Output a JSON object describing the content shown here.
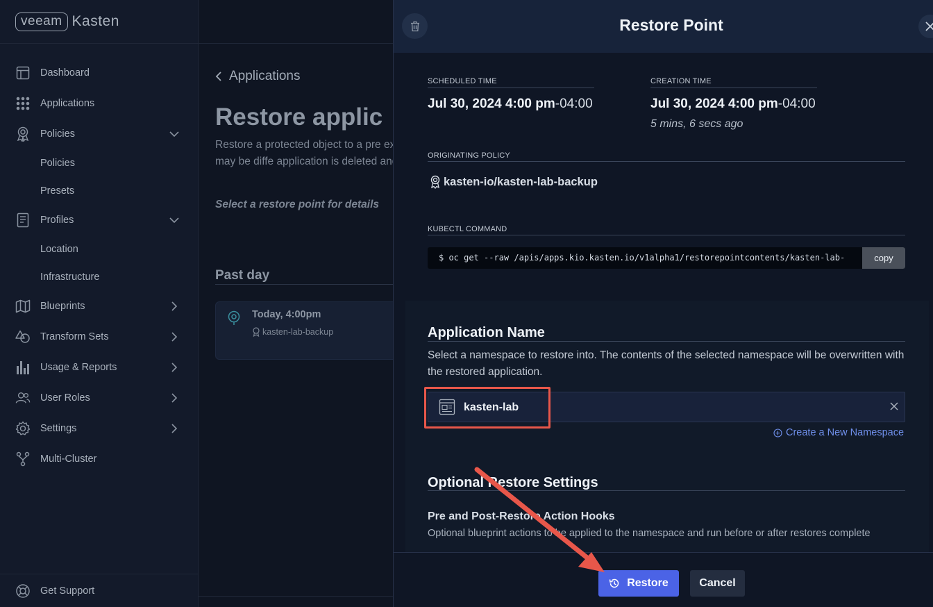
{
  "brand": {
    "veeam": "veeam",
    "kasten": "Kasten"
  },
  "sidebar": {
    "items": [
      {
        "label": "Dashboard",
        "icon": "dashboard-icon"
      },
      {
        "label": "Applications",
        "icon": "grid-icon"
      },
      {
        "label": "Policies",
        "icon": "badge-icon"
      },
      {
        "label": "Policies",
        "icon": ""
      },
      {
        "label": "Presets",
        "icon": ""
      },
      {
        "label": "Profiles",
        "icon": "document-icon"
      },
      {
        "label": "Location",
        "icon": ""
      },
      {
        "label": "Infrastructure",
        "icon": ""
      },
      {
        "label": "Blueprints",
        "icon": "map-icon"
      },
      {
        "label": "Transform Sets",
        "icon": "shapes-icon"
      },
      {
        "label": "Usage & Reports",
        "icon": "bar-chart-icon"
      },
      {
        "label": "User Roles",
        "icon": "users-icon"
      },
      {
        "label": "Settings",
        "icon": "gear-icon"
      },
      {
        "label": "Multi-Cluster",
        "icon": "fork-icon"
      }
    ],
    "support": "Get Support"
  },
  "main": {
    "back_label": "Applications",
    "title": "Restore applic",
    "description": "Restore a protected object to a pre execution time which may be diffe application is deleted and then rec",
    "hint": "Select a restore point for details",
    "section": "Past day",
    "card": {
      "time": "Today, 4:00pm",
      "policy": "kasten-lab-backup"
    }
  },
  "panel": {
    "title": "Restore Point",
    "scheduled_label": "SCHEDULED TIME",
    "scheduled_time": "Jul 30, 2024 4:00 pm",
    "scheduled_tz": "-04:00",
    "creation_label": "CREATION TIME",
    "creation_time": "Jul 30, 2024 4:00 pm",
    "creation_tz": "-04:00",
    "creation_ago": "5 mins, 6 secs ago",
    "policy_label": "ORIGINATING POLICY",
    "policy": "kasten-io/kasten-lab-backup",
    "kubectl_label": "KUBECTL COMMAND",
    "kubectl_cmd": "$ oc get --raw /apis/apps.kio.kasten.io/v1alpha1/restorepointcontents/kasten-lab-",
    "copy": "copy",
    "app_name_title": "Application Name",
    "app_name_desc": "Select a namespace to restore into. The contents of the selected namespace will be overwritten with the restored application.",
    "namespace": "kasten-lab",
    "create_ns": "Create a New Namespace",
    "optional_title": "Optional Restore Settings",
    "hooks_title": "Pre and Post-Restore Action Hooks",
    "hooks_desc": "Optional blueprint actions to be applied to the namespace and run before or after restores complete",
    "restore": "Restore",
    "cancel": "Cancel"
  },
  "colors": {
    "accent": "#4b63e6",
    "highlight": "#e8574a",
    "link": "#6f8fea"
  }
}
